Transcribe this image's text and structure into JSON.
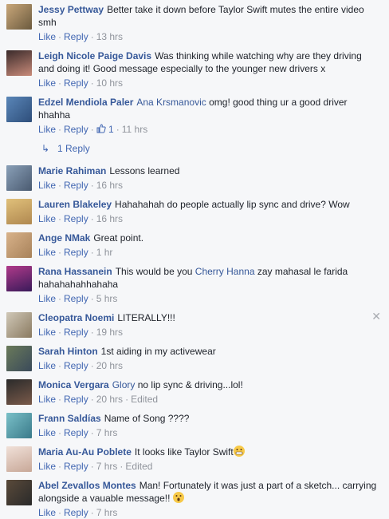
{
  "comments": [
    {
      "name": "Jessy Pettway",
      "text": "Better take it down before Taylor Swift mutes the entire video smh",
      "time": "13 hrs"
    },
    {
      "name": "Leigh Nicole Paige Davis",
      "text": "Was thinking while watching why are they driving and doing it! Good message especially to the younger new drivers x",
      "time": "10 hrs"
    },
    {
      "name": "Edzel Mendiola Paler",
      "mention": "Ana Krsmanovic",
      "text": "omg! good thing ur a good driver hhahha",
      "likes": "1",
      "time": "11 hrs"
    },
    {
      "name": "Marie Rahiman",
      "text": "Lessons learned",
      "time": "16 hrs"
    },
    {
      "name": "Lauren Blakeley",
      "text": "Hahahahah do people actually lip sync and drive? Wow",
      "time": "16 hrs"
    },
    {
      "name": "Ange NMak",
      "text": "Great point.",
      "time": "1 hr"
    },
    {
      "name": "Rana Hassanein",
      "text": "This would be you",
      "mention": "Cherry Hanna",
      "text2": "zay mahasal le farida hahahahahhahaha",
      "time": "5 hrs"
    },
    {
      "name": "Cleopatra Noemi",
      "text": "LITERALLY!!!",
      "time": "19 hrs"
    },
    {
      "name": "Sarah Hinton",
      "text": "1st aiding in my activewear",
      "time": "20 hrs"
    },
    {
      "name": "Monica Vergara",
      "mention": "Glory",
      "text": "no lip sync & driving...lol!",
      "time": "20 hrs",
      "edited": "Edited"
    },
    {
      "name": "Frann Saldías",
      "text": "Name of Song ????",
      "time": "7 hrs"
    },
    {
      "name": "Maria Au-Au Poblete",
      "text": "It looks like Taylor Swift",
      "time": "7 hrs",
      "edited": "Edited"
    },
    {
      "name": "Abel Zevallos Montes",
      "text": "Man! Fortunately it was just a part of a sketch... carrying alongside a vauable message!!",
      "time": "7 hrs"
    }
  ],
  "actions": {
    "like": "Like",
    "reply": "Reply",
    "sep": "·"
  },
  "replies_link": "1 Reply",
  "colors": {
    "link": "#365899",
    "action": "#4267b2",
    "meta": "#90949c",
    "background": "#f6f7f9"
  }
}
